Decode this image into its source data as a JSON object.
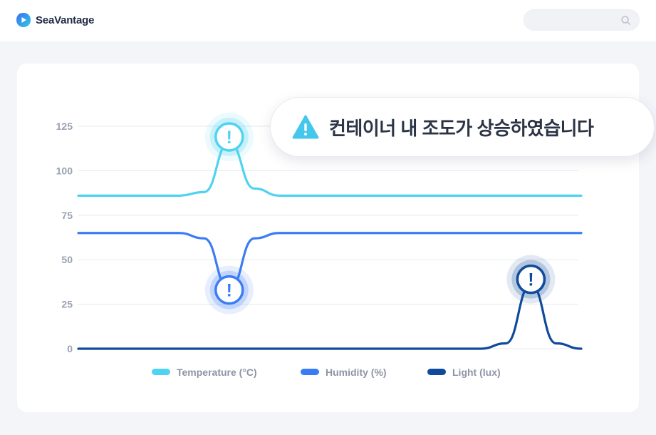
{
  "app": {
    "brand": "SeaVantage"
  },
  "search": {
    "placeholder": "",
    "icon": "search-icon"
  },
  "alert": {
    "message": "컨테이너 내 조도가 상승하였습니다",
    "icon": "warning-triangle-icon",
    "icon_color": "#45c6ec"
  },
  "chart_data": {
    "type": "line",
    "title": "",
    "xlabel": "",
    "ylabel": "",
    "ylim": [
      0,
      125
    ],
    "yticks": [
      0,
      25,
      50,
      75,
      100,
      125
    ],
    "grid": true,
    "legend_position": "bottom",
    "x": [
      0,
      4,
      5,
      6,
      7,
      8,
      9,
      10,
      11,
      12,
      13,
      14,
      15,
      16,
      17,
      18,
      19,
      20
    ],
    "series": [
      {
        "name": "Temperature (°C)",
        "color": "#4fd3f0",
        "values": [
          86,
          86,
          88,
          116,
          90,
          86,
          86,
          86,
          86,
          86,
          86,
          86,
          86,
          86,
          86,
          86,
          86,
          86
        ]
      },
      {
        "name": "Humidity (%)",
        "color": "#3b7cf5",
        "values": [
          65,
          65,
          62,
          33,
          62,
          65,
          65,
          65,
          65,
          65,
          65,
          65,
          65,
          65,
          65,
          65,
          65,
          65
        ]
      },
      {
        "name": "Light (lux)",
        "color": "#0f4a9c",
        "values": [
          0,
          0,
          0,
          0,
          0,
          0,
          0,
          0,
          0,
          0,
          0,
          0,
          0,
          0,
          3,
          36,
          3,
          0
        ]
      }
    ],
    "markers": [
      {
        "series": "Temperature (°C)",
        "x": 6,
        "y": 119,
        "label": "!"
      },
      {
        "series": "Humidity (%)",
        "x": 6,
        "y": 33,
        "label": "!"
      },
      {
        "series": "Light (lux)",
        "x": 18,
        "y": 39,
        "label": "!"
      }
    ]
  }
}
